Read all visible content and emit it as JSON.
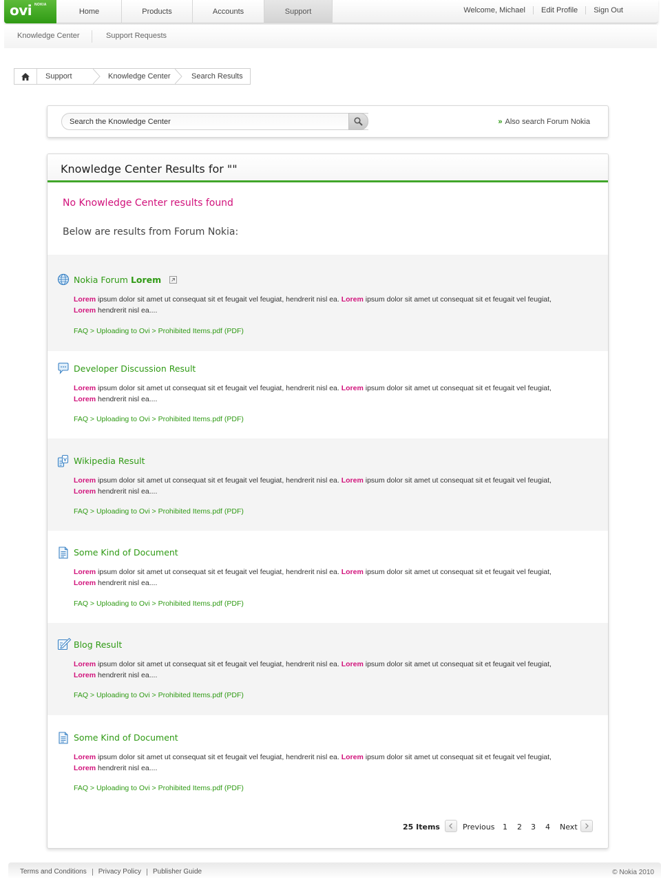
{
  "brand": {
    "logo": "ovi",
    "sub": "NOKIA"
  },
  "nav": {
    "tabs": [
      {
        "label": "Home"
      },
      {
        "label": "Products"
      },
      {
        "label": "Accounts"
      },
      {
        "label": "Support",
        "active": true
      }
    ],
    "user": {
      "welcome": "Welcome, Michael",
      "edit_profile": "Edit Profile",
      "sign_out": "Sign Out"
    }
  },
  "subnav": {
    "items": [
      "Knowledge Center",
      "Support Requests"
    ]
  },
  "breadcrumb": {
    "items": [
      "Support",
      "Knowledge Center",
      "Search Results"
    ]
  },
  "search": {
    "placeholder": "Search the Knowledge Center",
    "also": "Also search Forum Nokia"
  },
  "results": {
    "title": "Knowledge Center Results for \"\"",
    "none_found": "No Knowledge Center results found",
    "below": "Below are results from Forum Nokia:",
    "items": [
      {
        "icon": "globe-icon",
        "title": "Nokia Forum",
        "title_bold": "Lorem",
        "external": true,
        "hl": "Lorem",
        "text1": " ipsum dolor sit amet ut consequat sit et feugait vel feugiat, hendrerit nisl ea. ",
        "text2": " ipsum dolor sit amet ut consequat sit et feugait vel feugiat,",
        "text3": " hendrerit nisl ea....",
        "path": "FAQ > Uploading to Ovi > Prohibited Items.pdf (PDF)"
      },
      {
        "icon": "speech-bubble-icon",
        "title": "Developer Discussion Result",
        "title_bold": "",
        "external": false,
        "hl": "Lorem",
        "text1": " ipsum dolor sit amet ut consequat sit et feugait vel feugiat, hendrerit nisl ea. ",
        "text2": " ipsum dolor sit amet ut consequat sit et feugait vel feugiat,",
        "text3": " hendrerit nisl ea....",
        "path": "FAQ > Uploading to Ovi > Prohibited Items.pdf (PDF)"
      },
      {
        "icon": "wikipedia-icon",
        "title": "Wikipedia Result",
        "title_bold": "",
        "external": false,
        "hl": "Lorem",
        "text1": " ipsum dolor sit amet ut consequat sit et feugait vel feugiat, hendrerit nisl ea. ",
        "text2": " ipsum dolor sit amet ut consequat sit et feugait vel feugiat,",
        "text3": " hendrerit nisl ea....",
        "path": "FAQ > Uploading to Ovi > Prohibited Items.pdf (PDF)"
      },
      {
        "icon": "document-icon",
        "title": "Some Kind of Document",
        "title_bold": "",
        "external": false,
        "hl": "Lorem",
        "text1": " ipsum dolor sit amet ut consequat sit et feugait vel feugiat, hendrerit nisl ea. ",
        "text2": " ipsum dolor sit amet ut consequat sit et feugait vel feugiat,",
        "text3": " hendrerit nisl ea....",
        "path": "FAQ > Uploading to Ovi > Prohibited Items.pdf (PDF)"
      },
      {
        "icon": "blog-pencil-icon",
        "title": "Blog Result",
        "title_bold": "",
        "external": false,
        "hl": "Lorem",
        "text1": " ipsum dolor sit amet ut consequat sit et feugait vel feugiat, hendrerit nisl ea. ",
        "text2": " ipsum dolor sit amet ut consequat sit et feugait vel feugiat,",
        "text3": " hendrerit nisl ea....",
        "path": "FAQ > Uploading to Ovi > Prohibited Items.pdf (PDF)"
      },
      {
        "icon": "document-icon",
        "title": "Some Kind of Document",
        "title_bold": "",
        "external": false,
        "hl": "Lorem",
        "text1": " ipsum dolor sit amet ut consequat sit et feugait vel feugiat, hendrerit nisl ea. ",
        "text2": " ipsum dolor sit amet ut consequat sit et feugait vel feugiat,",
        "text3": " hendrerit nisl ea....",
        "path": "FAQ > Uploading to Ovi > Prohibited Items.pdf (PDF)"
      }
    ]
  },
  "pagination": {
    "count": "25 Items",
    "previous": "Previous",
    "pages": [
      "1",
      "2",
      "3",
      "4"
    ],
    "next": "Next"
  },
  "footer": {
    "links": [
      "Terms and Conditions",
      "Privacy Policy",
      "Publisher Guide"
    ],
    "copyright": "© Nokia 2010"
  },
  "colors": {
    "accent_green": "#2f9a14",
    "highlight_magenta": "#d1127b"
  }
}
